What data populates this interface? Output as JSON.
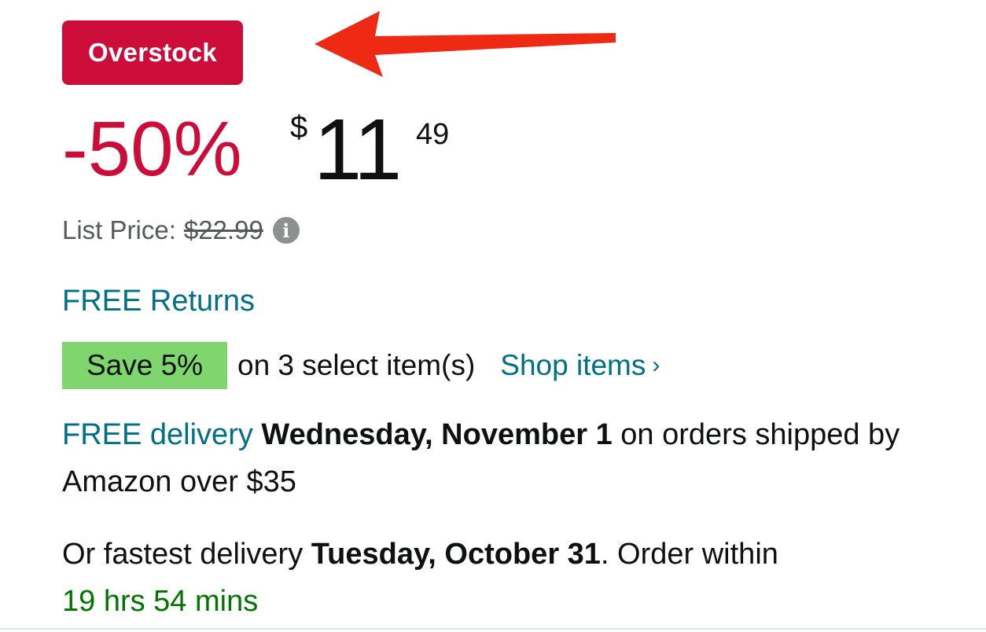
{
  "badge": {
    "label": "Overstock",
    "color": "#cc0c39"
  },
  "annotation": {
    "arrow_icon": "red-arrow-pointing-left",
    "color": "#ee2a14"
  },
  "price": {
    "discount": "-50%",
    "currency_symbol": "$",
    "whole": "11",
    "fraction": "49"
  },
  "list_price": {
    "label": "List Price:",
    "value": "$22.99",
    "info_icon": "info-icon"
  },
  "returns": {
    "label": "FREE Returns"
  },
  "coupon": {
    "badge": "Save 5%",
    "text": "on 3 select item(s)",
    "link": "Shop items",
    "chevron": "›",
    "badge_color": "#7fd66f"
  },
  "delivery": {
    "link": "FREE delivery",
    "date": "Wednesday, November 1",
    "rest": " on orders shipped by Amazon over $35"
  },
  "fastest": {
    "prefix": "Or fastest delivery ",
    "date": "Tuesday, October 31",
    "middle": ". Order within",
    "countdown": "19 hrs 54 mins"
  }
}
